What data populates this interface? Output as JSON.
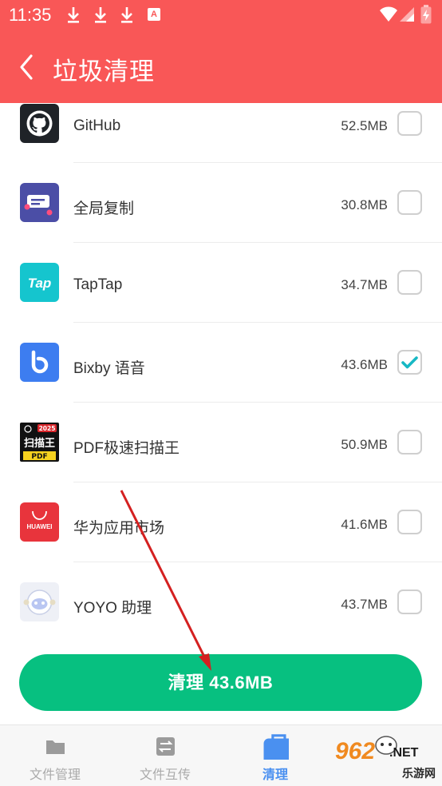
{
  "status_bar": {
    "time": "11:35",
    "a_badge": "A"
  },
  "header": {
    "title": "垃圾清理"
  },
  "apps": [
    {
      "name": "GitHub",
      "size": "52.5MB",
      "checked": false,
      "icon": "github-icon"
    },
    {
      "name": "全局复制",
      "size": "30.8MB",
      "checked": false,
      "icon": "global-copy-icon"
    },
    {
      "name": "TapTap",
      "size": "34.7MB",
      "checked": false,
      "icon": "taptap-icon",
      "icon_text": "Tap"
    },
    {
      "name": "Bixby 语音",
      "size": "43.6MB",
      "checked": true,
      "icon": "bixby-icon"
    },
    {
      "name": "PDF极速扫描王",
      "size": "50.9MB",
      "checked": false,
      "icon": "pdf-scanner-icon",
      "icon_text": [
        "2025",
        "扫描王",
        "PDF"
      ]
    },
    {
      "name": "华为应用市场",
      "size": "41.6MB",
      "checked": false,
      "icon": "huawei-appgallery-icon",
      "icon_text": "HUAWEI"
    },
    {
      "name": "YOYO 助理",
      "size": "43.7MB",
      "checked": false,
      "icon": "yoyo-icon"
    }
  ],
  "clean_button": {
    "label": "清理 43.6MB"
  },
  "tabs": [
    {
      "label": "文件管理",
      "icon": "folder-icon",
      "active": false
    },
    {
      "label": "文件互传",
      "icon": "transfer-icon",
      "active": false
    },
    {
      "label": "清理",
      "icon": "clean-bag-icon",
      "active": true
    }
  ],
  "watermark": {
    "number": "962",
    "domain": ".NET",
    "site_name": "乐游网"
  },
  "colors": {
    "header": "#f95757",
    "button": "#07c080",
    "check": "#17b8c4",
    "tab_active": "#4a90f0",
    "arrow": "#d42020"
  }
}
